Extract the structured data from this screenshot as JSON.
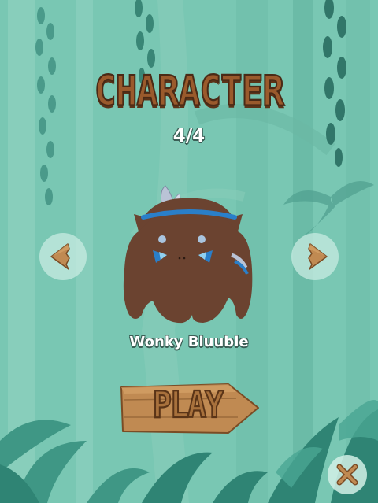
{
  "screen": {
    "title": "CHARACTER",
    "counter": "4/4"
  },
  "character": {
    "name": "Wonky Bluubie"
  },
  "buttons": {
    "prev_icon": "arrow-left-icon",
    "next_icon": "arrow-right-icon",
    "play_label": "PLAY",
    "close_icon": "close-icon"
  },
  "colors": {
    "background": "#79c7b3",
    "character_body": "#6b4330",
    "character_accent": "#2a7fc9",
    "wood": "#c08a52"
  }
}
